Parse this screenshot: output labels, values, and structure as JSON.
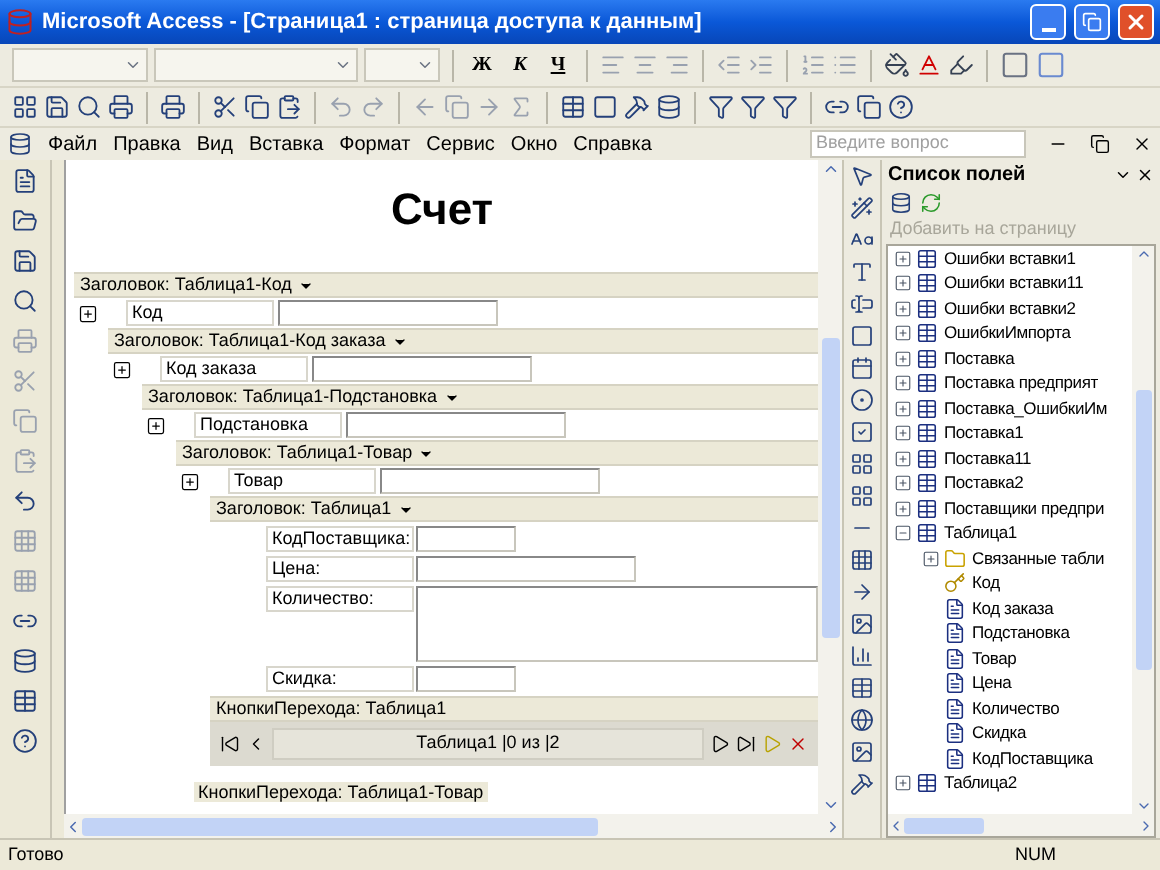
{
  "window": {
    "title": "Microsoft Access - [Страница1 : страница доступа к данным]"
  },
  "format_toolbar": {
    "buttons": [
      "Ж",
      "К",
      "Ч"
    ]
  },
  "menu": {
    "items": [
      "Файл",
      "Правка",
      "Вид",
      "Вставка",
      "Формат",
      "Сервис",
      "Окно",
      "Справка"
    ],
    "help_placeholder": "Введите вопрос"
  },
  "page": {
    "title": "Счет",
    "groups": [
      {
        "header": "Заголовок: Таблица1-Код",
        "expanded": false,
        "label": "Код",
        "children": [
          {
            "header": "Заголовок: Таблица1-Код заказа",
            "expanded": false,
            "label": "Код заказа",
            "children": [
              {
                "header": "Заголовок: Таблица1-Подстановка",
                "expanded": false,
                "label": "Подстановка",
                "children": [
                  {
                    "header": "Заголовок: Таблица1-Товар",
                    "expanded": false,
                    "label": "Товар",
                    "children": [
                      {
                        "header": "Заголовок: Таблица1",
                        "fields": [
                          {
                            "label": "КодПоставщика:",
                            "kind": "short"
                          },
                          {
                            "label": "Цена:",
                            "kind": "wide"
                          },
                          {
                            "label": "Количество:",
                            "kind": "memo"
                          },
                          {
                            "label": "Скидка:",
                            "kind": "short"
                          }
                        ],
                        "navigation": {
                          "header": "КнопкиПерехода: Таблица1",
                          "record": "Таблица1 |0 из |2"
                        }
                      }
                    ]
                  }
                ]
              }
            ]
          }
        ]
      }
    ],
    "footer": "КнопкиПерехода: Таблица1-Товар"
  },
  "field_list": {
    "title": "Список полей",
    "add_button": {
      "label": "Добавить на страницу",
      "disabled": true
    },
    "items": [
      {
        "name": "Ошибки вставки1",
        "kind": "table",
        "expanded": false
      },
      {
        "name": "Ошибки вставки11",
        "kind": "table",
        "expanded": false
      },
      {
        "name": "Ошибки вставки2",
        "kind": "table",
        "expanded": false
      },
      {
        "name": "ОшибкиИмпорта",
        "kind": "table",
        "expanded": false
      },
      {
        "name": "Поставка",
        "kind": "table",
        "expanded": false
      },
      {
        "name": "Поставка предприят",
        "kind": "table",
        "expanded": false
      },
      {
        "name": "Поставка_ОшибкиИм",
        "kind": "table",
        "expanded": false
      },
      {
        "name": "Поставка1",
        "kind": "table",
        "expanded": false
      },
      {
        "name": "Поставка11",
        "kind": "table",
        "expanded": false
      },
      {
        "name": "Поставка2",
        "kind": "table",
        "expanded": false
      },
      {
        "name": "Поставщики предпри",
        "kind": "table",
        "expanded": false
      },
      {
        "name": "Таблица1",
        "kind": "table",
        "expanded": true,
        "children": [
          {
            "name": "Связанные табли",
            "kind": "folder",
            "expanded": false
          },
          {
            "name": "Код",
            "kind": "key_field"
          },
          {
            "name": "Код заказа",
            "kind": "field"
          },
          {
            "name": "Подстановка",
            "kind": "field"
          },
          {
            "name": "Товар",
            "kind": "field"
          },
          {
            "name": "Цена",
            "kind": "field"
          },
          {
            "name": "Количество",
            "kind": "field"
          },
          {
            "name": "Скидка",
            "kind": "field"
          },
          {
            "name": "КодПоставщика",
            "kind": "field"
          }
        ]
      },
      {
        "name": "Таблица2",
        "kind": "table",
        "expanded": false
      }
    ]
  },
  "status_bar": {
    "message": "Готово",
    "indicator": "NUM"
  }
}
